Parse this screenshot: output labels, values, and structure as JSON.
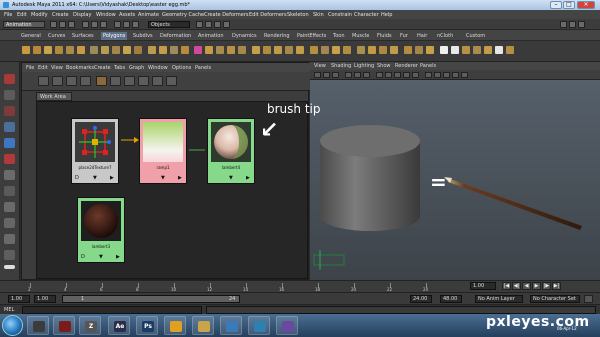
{
  "window": {
    "title": "Autodesk Maya 2011 x64: C:\\Users\\Vidyashak\\Desktop\\easter egg.mb*",
    "minimize": "–",
    "maximize": "□",
    "close": "✕"
  },
  "menubar": [
    "File",
    "Edit",
    "Modify",
    "Create",
    "Display",
    "Window",
    "Assets",
    "Animate",
    "Geometry Cache",
    "Create Deformers",
    "Edit Deformers",
    "Skeleton",
    "Skin",
    "Constrain",
    "Character",
    "Help"
  ],
  "statusline": {
    "mode": "Animation",
    "objects_field": "Objects"
  },
  "shelf_tabs": [
    "General",
    "Curves",
    "Surfaces",
    "Polygons",
    "Subdivs",
    "Deformation",
    "Animation",
    "Dynamics",
    "Rendering",
    "PaintEffects",
    "Toon",
    "Muscle",
    "Fluids",
    "Fur",
    "Hair",
    "nCloth",
    "Custom"
  ],
  "shelf_active_tab": "Polygons",
  "hypershade": {
    "menu": [
      "File",
      "Edit",
      "View",
      "Bookmarks",
      "Create",
      "Tabs",
      "Graph",
      "Window",
      "Options",
      "Panels"
    ],
    "tab": "Work Area",
    "nodes": [
      {
        "label": "place2dTexture7",
        "foot": [
          "D",
          "▼",
          "▶"
        ]
      },
      {
        "label": "ramp1",
        "foot": [
          "",
          "▼",
          "▶"
        ]
      },
      {
        "label": "lambert4",
        "foot": [
          "",
          "▼",
          "▶"
        ]
      },
      {
        "label": "lambert3",
        "foot": [
          "D",
          "▼",
          "▶"
        ]
      }
    ]
  },
  "viewport": {
    "menu": [
      "View",
      "Shading",
      "Lighting",
      "Show",
      "Renderer",
      "Panels"
    ],
    "annotation": "brush tip",
    "arrow_glyph": "↙",
    "equals_glyph": "="
  },
  "timeline": {
    "ticks": [
      "2",
      "4",
      "6",
      "8",
      "10",
      "12",
      "14",
      "16",
      "18",
      "20",
      "22",
      "24"
    ],
    "current_frame": "1.00"
  },
  "range": {
    "start": "1.00",
    "inner_start": "1.00",
    "slider_value": "1",
    "slider_end": "24",
    "inner_end": "24.00",
    "end": "48.00",
    "anim_layer": "No Anim Layer",
    "char_set": "No Character Set"
  },
  "playback": [
    "|◀",
    "◀|",
    "◀",
    "▶",
    "|▶",
    "▶|"
  ],
  "mel_label": "MEL",
  "taskbar": {
    "items": [
      {
        "glyph": "",
        "color": "#3c3c3c"
      },
      {
        "glyph": "",
        "color": "#7a1c1c"
      },
      {
        "glyph": "Z",
        "color": "#555555"
      },
      {
        "glyph": "Ae",
        "color": "#2b2b4a"
      },
      {
        "glyph": "Ps",
        "color": "#1b3b63"
      },
      {
        "glyph": "",
        "color": "#e0a020"
      },
      {
        "glyph": "",
        "color": "#c9a44b"
      },
      {
        "glyph": "",
        "color": "#3a7ab8"
      },
      {
        "glyph": "",
        "color": "#2f7fb0"
      },
      {
        "glyph": "",
        "color": "#6a4aa0"
      }
    ],
    "watermark": "pxleyes.com",
    "date": "06-Apr-12"
  },
  "colors": {
    "place2d_node": "#c8c8c8",
    "ramp_node": "#f0a0a8",
    "lambert_node": "#86d98a",
    "connection": "#e3a000"
  }
}
